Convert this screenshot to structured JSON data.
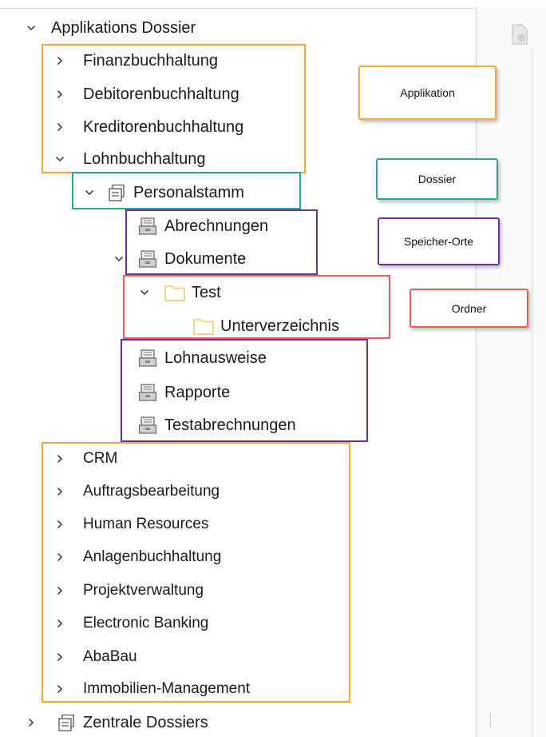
{
  "tree": {
    "root": {
      "label": "Applikations Dossier"
    },
    "applications_top": [
      {
        "label": "Finanzbuchhaltung"
      },
      {
        "label": "Debitorenbuchhaltung"
      },
      {
        "label": "Kreditorenbuchhaltung"
      },
      {
        "label": "Lohnbuchhaltung"
      }
    ],
    "dossier": {
      "label": "Personalstamm"
    },
    "storage_group1": [
      {
        "label": "Abrechnungen"
      },
      {
        "label": "Dokumente"
      }
    ],
    "folders": [
      {
        "label": "Test"
      },
      {
        "label": "Unterverzeichnis"
      }
    ],
    "storage_group2": [
      {
        "label": "Lohnausweise"
      },
      {
        "label": "Rapporte"
      },
      {
        "label": "Testabrechnungen"
      }
    ],
    "applications_bottom": [
      {
        "label": "CRM"
      },
      {
        "label": "Auftragsbearbeitung"
      },
      {
        "label": "Human Resources"
      },
      {
        "label": "Anlagenbuchhaltung"
      },
      {
        "label": "Projektverwaltung"
      },
      {
        "label": "Electronic Banking"
      },
      {
        "label": "AbaBau"
      },
      {
        "label": "Immobilien-Management"
      }
    ],
    "central": {
      "label": "Zentrale Dossiers"
    }
  },
  "legend": {
    "application": "Applikation",
    "dossier": "Dossier",
    "storage": "Speicher-Orte",
    "folder": "Ordner"
  },
  "colors": {
    "application": "#f1ab34",
    "dossier": "#2ba892",
    "storage": "#6c3295",
    "folder": "#f05a5a",
    "folder_icon": "#f7c86a"
  },
  "icons": {
    "collapsed": "chevron-right-icon",
    "expanded": "chevron-down-icon",
    "dossier": "dossier-icon",
    "storage": "storage-drawer-icon",
    "folder": "folder-icon"
  }
}
